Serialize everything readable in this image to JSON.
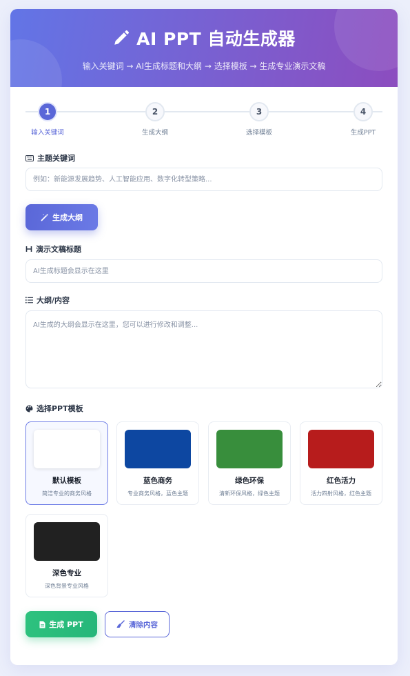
{
  "header": {
    "title": "AI PPT 自动生成器",
    "subtitle": "输入关键词 → AI生成标题和大纲 → 选择模板 → 生成专业演示文稿"
  },
  "steps": [
    {
      "number": "1",
      "label": "输入关键词",
      "active": true
    },
    {
      "number": "2",
      "label": "生成大纲",
      "active": false
    },
    {
      "number": "3",
      "label": "选择模板",
      "active": false
    },
    {
      "number": "4",
      "label": "生成PPT",
      "active": false
    }
  ],
  "keyword": {
    "label": "主题关键词",
    "placeholder": "例如：新能源发展趋势、人工智能应用、数字化转型策略...",
    "value": ""
  },
  "generate_outline_button": "生成大纲",
  "title_field": {
    "label": "演示文稿标题",
    "placeholder": "AI生成标题会显示在这里",
    "value": ""
  },
  "outline_field": {
    "label": "大纲/内容",
    "placeholder": "AI生成的大纲会显示在这里，您可以进行修改和调整...",
    "value": ""
  },
  "templates": {
    "label": "选择PPT模板",
    "selected": "默认模板",
    "items": [
      {
        "name": "默认模板",
        "desc": "简洁专业的商务风格",
        "color": "#ffffff"
      },
      {
        "name": "蓝色商务",
        "desc": "专业商务风格，蓝色主题",
        "color": "#0d47a1"
      },
      {
        "name": "绿色环保",
        "desc": "清新环保风格，绿色主题",
        "color": "#388e3c"
      },
      {
        "name": "红色活力",
        "desc": "活力四射风格，红色主题",
        "color": "#b71c1c"
      },
      {
        "name": "深色专业",
        "desc": "深色背景专业风格",
        "color": "#212121"
      }
    ]
  },
  "actions": {
    "generate_ppt": "生成 PPT",
    "clear": "清除内容"
  },
  "colors": {
    "accent": "#5a67d8",
    "success": "#2ec27e",
    "header_start": "#6275e6",
    "header_end": "#8c4dbf"
  }
}
